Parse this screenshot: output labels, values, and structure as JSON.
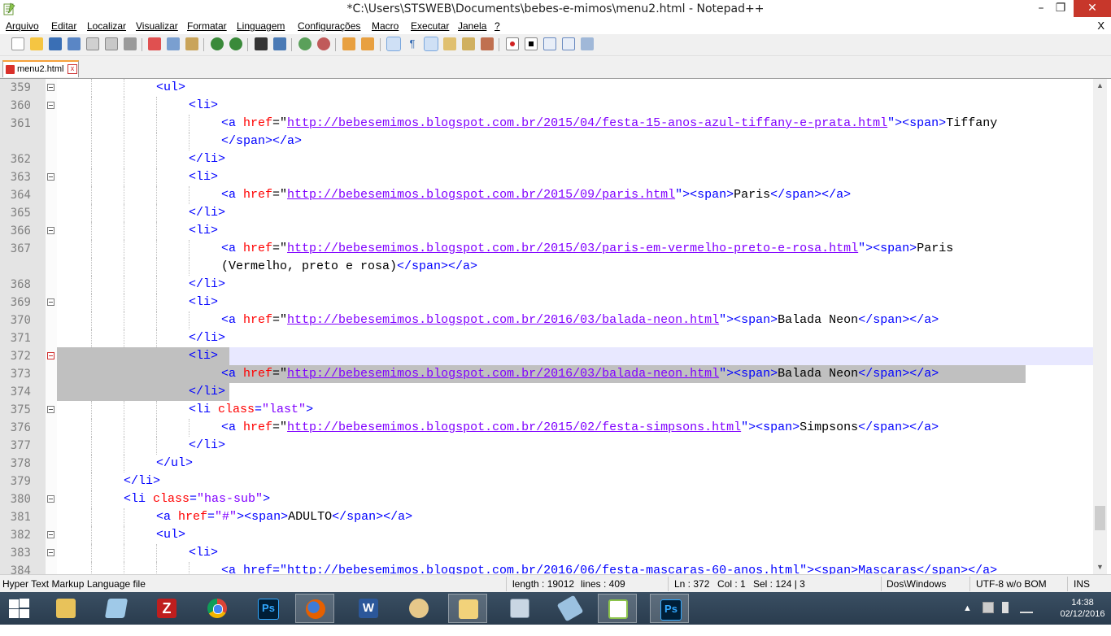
{
  "window": {
    "title": "*C:\\Users\\STSWEB\\Documents\\bebes-e-mimos\\menu2.html - Notepad++",
    "minimize": "–",
    "maximize": "❐",
    "close": "✕"
  },
  "menu": {
    "items": [
      "Arquivo",
      "Editar",
      "Localizar",
      "Visualizar",
      "Formatar",
      "Linguagem",
      "Configurações",
      "Macro",
      "Executar",
      "Janela",
      "?"
    ],
    "close_doc": "X"
  },
  "tab": {
    "label": "menu2.html",
    "close": "x"
  },
  "editor": {
    "current_line": 372,
    "lines": [
      {
        "n": "359",
        "fold": true
      },
      {
        "n": "360",
        "fold": true
      },
      {
        "n": "361",
        "fold": false
      },
      {
        "n": "",
        "fold": false
      },
      {
        "n": "362",
        "fold": false
      },
      {
        "n": "363",
        "fold": true
      },
      {
        "n": "364",
        "fold": false
      },
      {
        "n": "365",
        "fold": false
      },
      {
        "n": "366",
        "fold": true
      },
      {
        "n": "367",
        "fold": false
      },
      {
        "n": "",
        "fold": false
      },
      {
        "n": "368",
        "fold": false
      },
      {
        "n": "369",
        "fold": true
      },
      {
        "n": "370",
        "fold": false
      },
      {
        "n": "371",
        "fold": false
      },
      {
        "n": "372",
        "fold": true
      },
      {
        "n": "373",
        "fold": false
      },
      {
        "n": "374",
        "fold": false
      },
      {
        "n": "375",
        "fold": true
      },
      {
        "n": "376",
        "fold": false
      },
      {
        "n": "377",
        "fold": false
      },
      {
        "n": "378",
        "fold": false
      },
      {
        "n": "379",
        "fold": false
      },
      {
        "n": "380",
        "fold": true
      },
      {
        "n": "381",
        "fold": false
      },
      {
        "n": "382",
        "fold": true
      },
      {
        "n": "383",
        "fold": true
      },
      {
        "n": "384",
        "fold": false
      }
    ],
    "code": {
      "l359": "<ul>",
      "l360": "<li>",
      "l361_a": "<a ",
      "l361_attr": "href",
      "l361_eq": "=\"",
      "l361_url": "http://bebesemimos.blogspot.com.br/2015/04/festa-15-anos-azul-tiffany-e-prata.html",
      "l361_close": "\"><span>",
      "l361_text": "Tiffany",
      "l361b_tags": "</span></a>",
      "l362": "</li>",
      "l363": "<li>",
      "l364_url": "http://bebesemimos.blogspot.com.br/2015/09/paris.html",
      "l364_text": "Paris",
      "l364_end": "</span></a>",
      "l365": "</li>",
      "l366": "<li>",
      "l367_url": "http://bebesemimos.blogspot.com.br/2015/03/paris-em-vermelho-preto-e-rosa.html",
      "l367_text": "Paris",
      "l367b_text": "(Vermelho, preto e rosa)",
      "l367b_tags": "</span></a>",
      "l368": "</li>",
      "l369": "<li>",
      "l370_url": "http://bebesemimos.blogspot.com.br/2016/03/balada-neon.html",
      "l370_text": "Balada Neon",
      "l370_end": "</span></a>",
      "l371": "</li>",
      "l372": "<li>",
      "l373_url": "http://bebesemimos.blogspot.com.br/2016/03/balada-neon.html",
      "l373_text": "Balada Neon",
      "l373_end": "</span></a>",
      "l374": "</li>",
      "l375_tag": "<li ",
      "l375_attr": "class",
      "l375_val": "\"last\"",
      "l375_end": ">",
      "l376_url": "http://bebesemimos.blogspot.com.br/2015/02/festa-simpsons.html",
      "l376_text": "Simpsons",
      "l376_end": "</span></a>",
      "l377": "</li>",
      "l378": "</ul>",
      "l379": "</li>",
      "l380_tag": "<li ",
      "l380_attr": "class",
      "l380_val": "\"has-sub\"",
      "l380_end": ">",
      "l381_a": "<a ",
      "l381_attr": "href",
      "l381_val": "\"#\"",
      "l381_span": "><span>",
      "l381_text": "ADULTO",
      "l381_end": "</span></a>",
      "l382": "<ul>",
      "l383": "<li>",
      "l384": "<a href=\"http://bebesemimos.blogspot.com.br/2016/06/festa-mascaras-60-anos.html\"><span>Mascaras</span></a>"
    }
  },
  "status": {
    "language": "Hyper Text Markup Language file",
    "length": "length : 19012",
    "lines": "lines : 409",
    "ln": "Ln : 372",
    "col": "Col : 1",
    "sel": "Sel : 124 | 3",
    "eol": "Dos\\Windows",
    "encoding": "UTF-8 w/o BOM",
    "mode": "INS"
  },
  "taskbar": {
    "apps": [
      "windows-explorer",
      "file-explorer",
      "notepad",
      "filezilla",
      "chrome",
      "photoshop",
      "firefox",
      "word",
      "paint",
      "mail",
      "calculator",
      "sticky-notes",
      "notepad-plus-plus",
      "photoshop-2"
    ],
    "clock_time": "14:38",
    "clock_date": "02/12/2016",
    "colors": {
      "filezilla": "#bf1e1e",
      "chrome": "#2f9e46",
      "photoshop": "#001e36",
      "firefox": "#e66000",
      "word": "#2b579a",
      "npp": "#8bc34a"
    }
  }
}
